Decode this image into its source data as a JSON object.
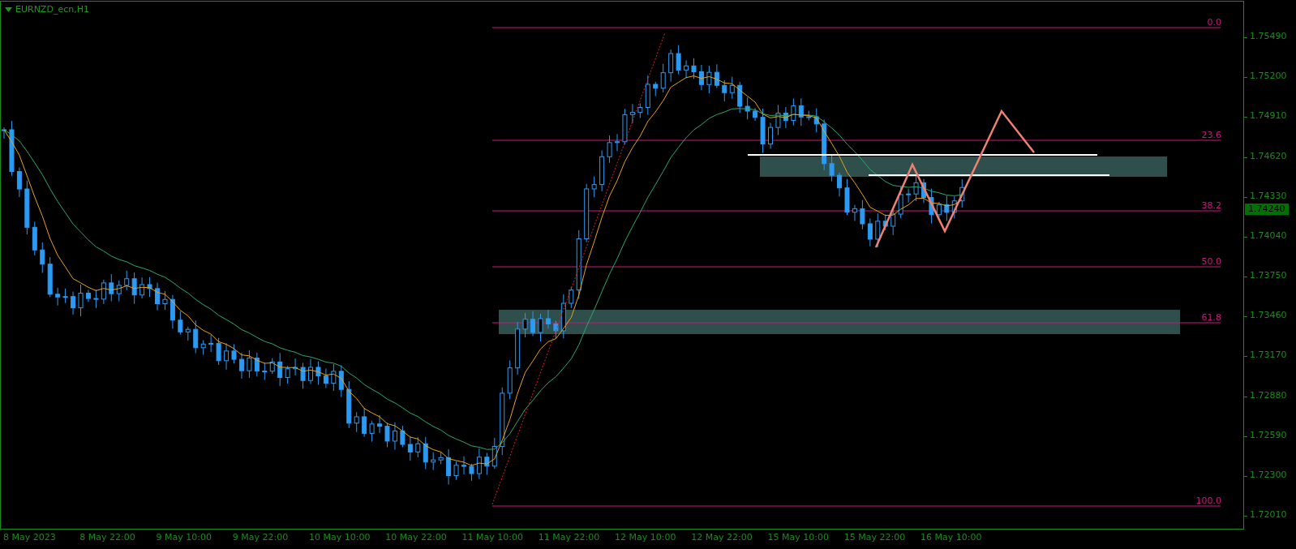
{
  "chart": {
    "title": "EURNZD_ecn,H1",
    "fibonacci_levels": [
      "0.0",
      "23.6",
      "38.2",
      "50.0",
      "61.8",
      "100.0"
    ],
    "price_axis": [
      "1.75490",
      "1.75200",
      "1.74910",
      "1.74620",
      "1.74330",
      "1.74040",
      "1.73750",
      "1.73460",
      "1.73170",
      "1.72880",
      "1.72590",
      "1.72300",
      "1.72010"
    ],
    "current_price": "1.74240",
    "time_axis": [
      "8 May 2023",
      "8 May 22:00",
      "9 May 10:00",
      "9 May 22:00",
      "10 May 10:00",
      "10 May 22:00",
      "11 May 10:00",
      "11 May 22:00",
      "12 May 10:00",
      "12 May 22:00",
      "15 May 10:00",
      "15 May 22:00",
      "16 May 10:00"
    ]
  }
}
